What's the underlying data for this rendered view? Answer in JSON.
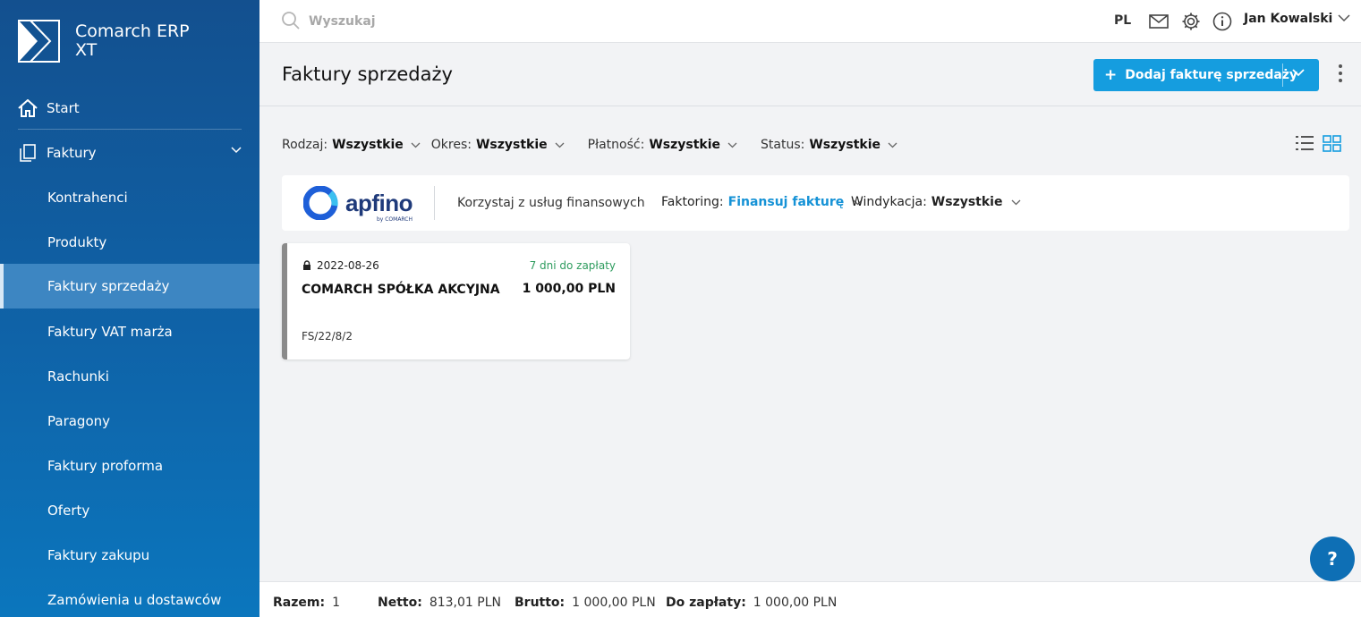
{
  "app": {
    "name_line1": "Comarch ERP",
    "name_line2": "XT"
  },
  "sidebar": {
    "items": [
      {
        "label": "Start",
        "icon": "home-icon"
      },
      {
        "label": "Faktury",
        "icon": "documents-icon",
        "expanded": true
      },
      {
        "label": "Kontrahenci"
      },
      {
        "label": "Produkty"
      },
      {
        "label": "Faktury sprzedaży",
        "active": true
      },
      {
        "label": "Faktury VAT marża"
      },
      {
        "label": "Rachunki"
      },
      {
        "label": "Paragony"
      },
      {
        "label": "Faktury proforma"
      },
      {
        "label": "Oferty"
      },
      {
        "label": "Faktury zakupu"
      },
      {
        "label": "Zamówienia u dostawców"
      }
    ]
  },
  "topbar": {
    "search_placeholder": "Wyszukaj",
    "lang": "PL",
    "user": "Jan Kowalski"
  },
  "header": {
    "title": "Faktury sprzedaży",
    "add_label": "Dodaj fakturę sprzedaży"
  },
  "filters": [
    {
      "label": "Rodzaj:",
      "value": "Wszystkie"
    },
    {
      "label": "Okres:",
      "value": "Wszystkie"
    },
    {
      "label": "Płatność:",
      "value": "Wszystkie"
    },
    {
      "label": "Status:",
      "value": "Wszystkie"
    }
  ],
  "apfino": {
    "logo_word": "apfino",
    "logo_by": "by COMARCH",
    "desc": "Korzystaj z usług finansowych",
    "factoring_label": "Faktoring:",
    "factoring_value": "Finansuj fakturę",
    "recovery_label": "Windykacja:",
    "recovery_value": "Wszystkie"
  },
  "invoice": {
    "date": "2022-08-26",
    "due": "7 dni do zapłaty",
    "client": "COMARCH SPÓŁKA AKCYJNA",
    "amount": "1 000,00 PLN",
    "number": "FS/22/8/2"
  },
  "footer": {
    "total_label": "Razem:",
    "total_value": "1",
    "net_label": "Netto:",
    "net_value": "813,01 PLN",
    "gross_label": "Brutto:",
    "gross_value": "1 000,00 PLN",
    "due_label": "Do zapłaty:",
    "due_value": "1 000,00 PLN"
  },
  "colors": {
    "accent": "#159ddf",
    "sidebar": "#13508f",
    "due_green": "#2e9c5e"
  }
}
